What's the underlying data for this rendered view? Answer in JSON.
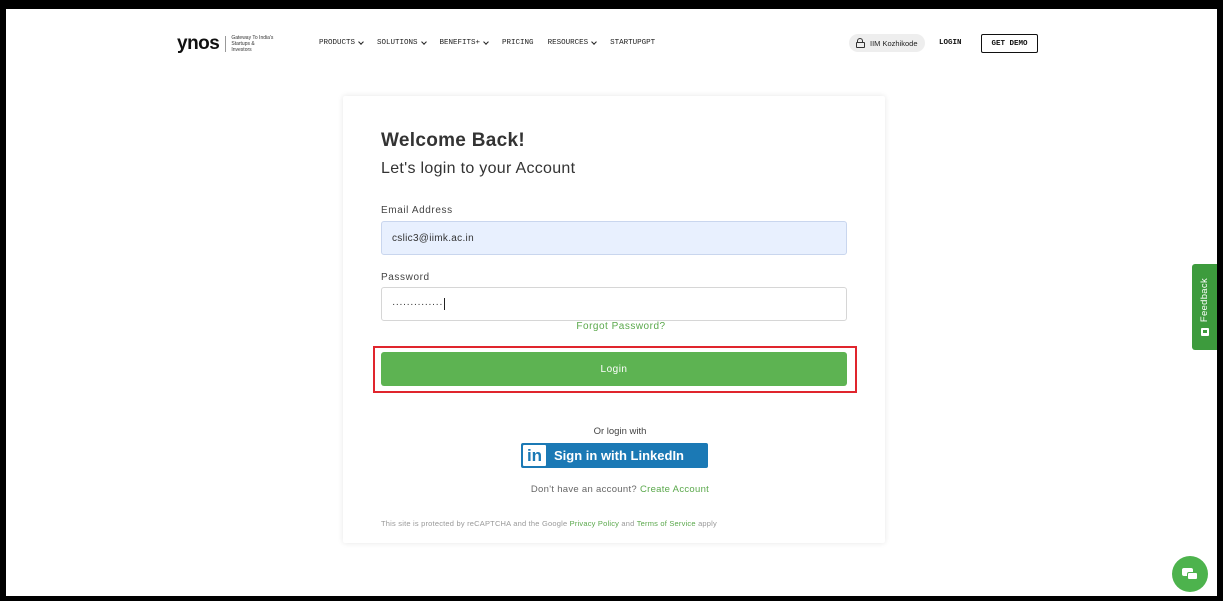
{
  "header": {
    "logo": {
      "word": "ynos",
      "tagline": "Gateway To India's Startups & Investors"
    },
    "nav": [
      {
        "label": "PRODUCTS",
        "dropdown": true
      },
      {
        "label": "SOLUTIONS",
        "dropdown": true
      },
      {
        "label": "BENEFITS+",
        "dropdown": true
      },
      {
        "label": "PRICING",
        "dropdown": false
      },
      {
        "label": "RESOURCES",
        "dropdown": true
      },
      {
        "label": "STARTUPGPT",
        "dropdown": false
      }
    ],
    "org_pill": {
      "label": "IIM Kozhikode",
      "icon": "unlock-icon"
    },
    "login_label": "LOGIN",
    "demo_label": "GET DEMO"
  },
  "login_card": {
    "title": "Welcome Back!",
    "subtitle": "Let's login to your Account",
    "email_label": "Email Address",
    "email_value": "cslic3@iimk.ac.in",
    "password_label": "Password",
    "password_value": "··············",
    "forgot_label": "Forgot Password?",
    "login_button": "Login",
    "or_login_with": "Or login with",
    "linkedin": {
      "logo_text": "in",
      "label": "Sign in with LinkedIn"
    },
    "no_account_text": "Don't have an account?",
    "create_account_label": "Create Account",
    "recaptcha": {
      "prefix": "This site is protected by reCAPTCHA and the Google",
      "privacy": "Privacy Policy",
      "and": "and",
      "terms": "Terms of Service",
      "suffix": "apply"
    }
  },
  "feedback_tab": {
    "label": "Feedback"
  },
  "colors": {
    "accent_green": "#5db352",
    "highlight_red": "#e0252d",
    "linkedin_blue": "#1b79b5"
  }
}
